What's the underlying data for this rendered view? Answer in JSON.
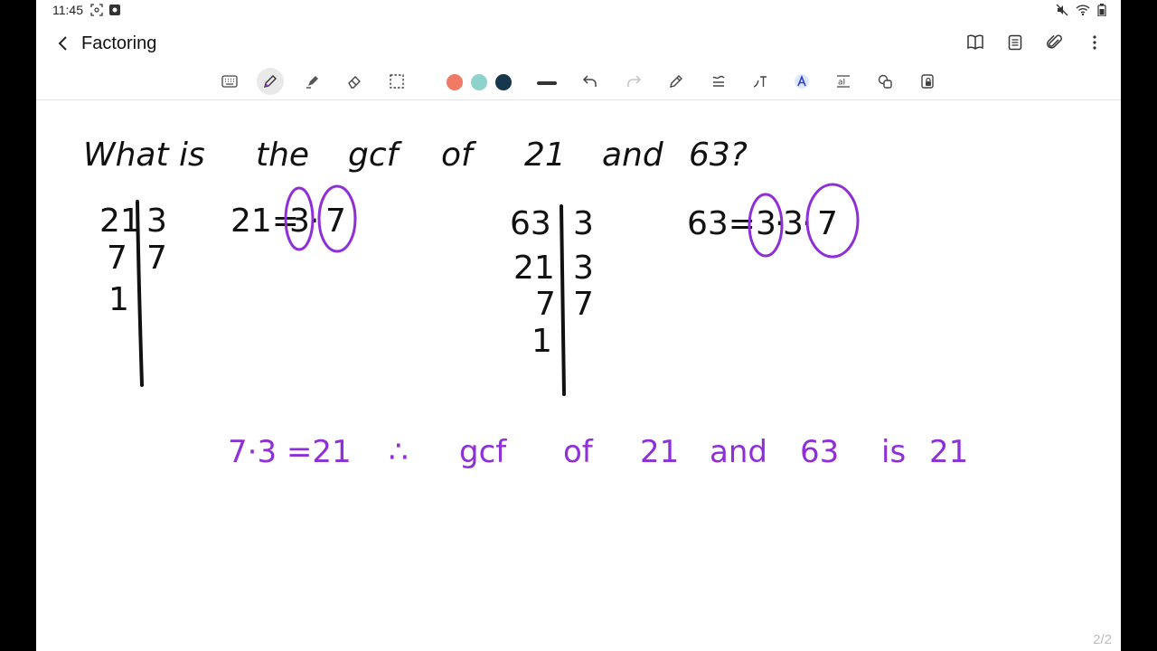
{
  "status": {
    "time": "11:45"
  },
  "app": {
    "title": "Factoring"
  },
  "pen_colors": {
    "coral": "#f07a66",
    "teal": "#8ed2cc",
    "navy": "#17374d",
    "ink": "#111111",
    "purple": "#8e2fd8"
  },
  "note": {
    "question": [
      "What",
      "is",
      "the",
      "gcf",
      "of",
      "21",
      "and",
      "63?"
    ],
    "ladder21": {
      "left": [
        "21",
        "7",
        "1"
      ],
      "right": [
        "3",
        "7"
      ]
    },
    "eq21": {
      "lhs": "21=",
      "factors": [
        "3",
        "7"
      ]
    },
    "ladder63": {
      "left": [
        "63",
        "21",
        "7",
        "1"
      ],
      "right": [
        "3",
        "3",
        "7"
      ]
    },
    "eq63": {
      "lhs": "63=",
      "factors": [
        "3",
        "3",
        "7"
      ]
    },
    "conclusion": [
      "7·3 =21",
      "∴",
      "gcf",
      "of",
      "21",
      "and",
      "63",
      "is",
      "21"
    ]
  },
  "page_indicator": "2/2"
}
